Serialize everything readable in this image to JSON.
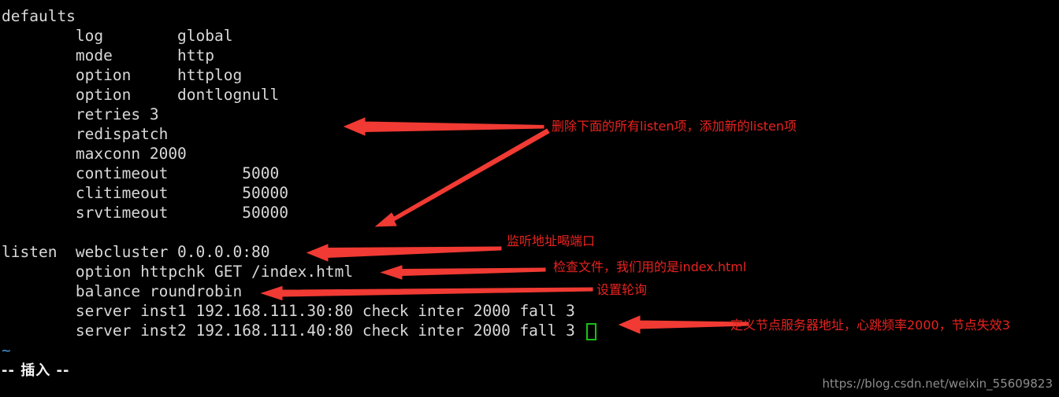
{
  "terminal": {
    "editor_mode_line": "-- 插入 --",
    "empty_line_marker": "~",
    "cursor": {
      "shape": "block-outline",
      "color": "#17c017"
    },
    "text_color": "#d8d8d8",
    "background_color": "#000000",
    "lines": [
      "defaults",
      "        log        global",
      "        mode       http",
      "        option     httplog",
      "        option     dontlognull",
      "        retries 3",
      "        redispatch",
      "        maxconn 2000",
      "        contimeout        5000",
      "        clitimeout        50000",
      "        srvtimeout        50000",
      "",
      "listen  webcluster 0.0.0.0:80",
      "        option httpchk GET /index.html",
      "        balance roundrobin",
      "        server inst1 192.168.111.30:80 check inter 2000 fall 3",
      "        server inst2 192.168.111.40:80 check inter 2000 fall 3"
    ]
  },
  "annotations": {
    "color": "#e8231f",
    "items": [
      {
        "id": "note-delete-listen",
        "text": "删除下面的所有listen项，添加新的listen项"
      },
      {
        "id": "note-listen-address",
        "text": "监听地址喝端口"
      },
      {
        "id": "note-check-file",
        "text": "检查文件，我们用的是index.html"
      },
      {
        "id": "note-roundrobin",
        "text": "设置轮询"
      },
      {
        "id": "note-server-nodes",
        "text": "定义节点服务器地址，心跳频率2000，节点失效3"
      }
    ]
  },
  "watermark": {
    "text": "https://blog.csdn.net/weixin_55609823"
  }
}
